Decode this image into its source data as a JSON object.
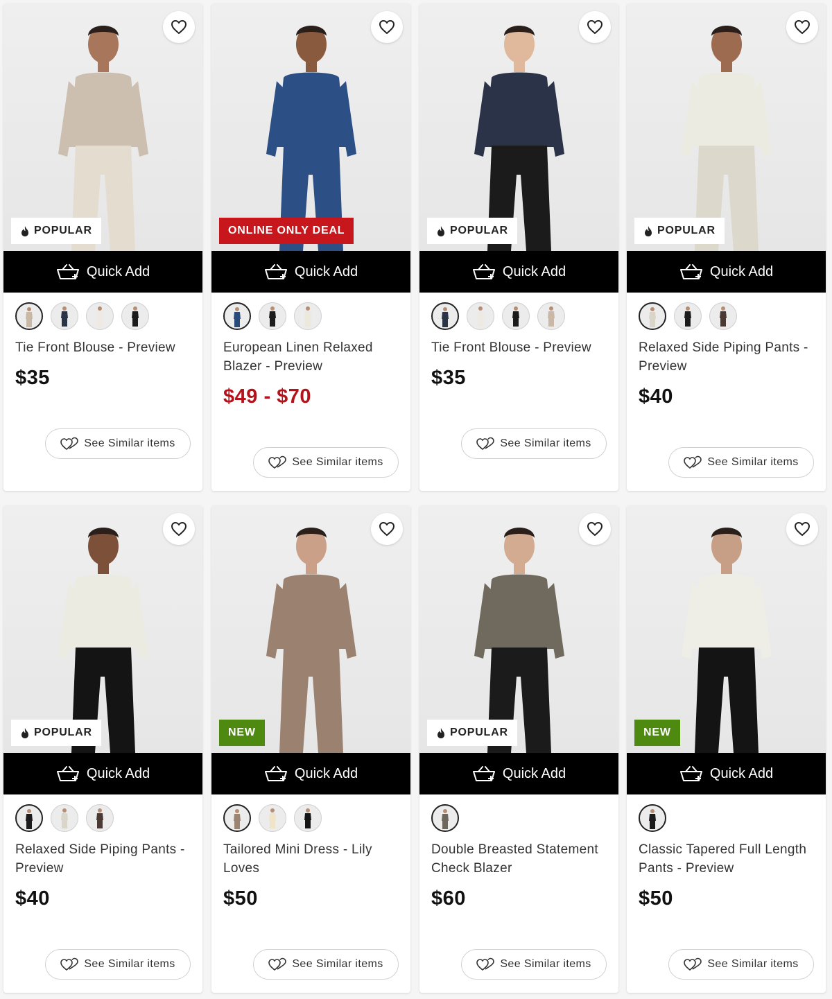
{
  "common": {
    "quick_add_label": "Quick Add",
    "similar_label": "See Similar items",
    "icons": {
      "favorite": "heart-icon",
      "quick_add": "basket-plus-icon",
      "similar": "hearts-icon",
      "popular": "flame-icon"
    },
    "colors": {
      "sale_price": "#b5121b",
      "badge_online": "#c8161d",
      "badge_new": "#4f8a10",
      "quick_add_bg": "#000000"
    }
  },
  "products": [
    {
      "title": "Tie Front Blouse - Preview",
      "price": "$35",
      "sale": false,
      "badge": {
        "type": "popular",
        "label": "POPULAR"
      },
      "swatches": [
        "#c9b8a6",
        "#2b3346",
        "#eeeae3",
        "#1a1a1a"
      ],
      "top_color": "#cdbfaf",
      "bottom_color": "#e4dccf"
    },
    {
      "title": "European Linen Relaxed Blazer - Preview",
      "price": "$49 - $70",
      "sale": true,
      "badge": {
        "type": "online",
        "label": "ONLINE ONLY DEAL"
      },
      "swatches": [
        "#284a7a",
        "#1c1c1c",
        "#ede8dc"
      ],
      "top_color": "#2c4f85",
      "bottom_color": "#2c4f85"
    },
    {
      "title": "Tie Front Blouse - Preview",
      "price": "$35",
      "sale": false,
      "badge": {
        "type": "popular",
        "label": "POPULAR"
      },
      "swatches": [
        "#2b3346",
        "#eeeae3",
        "#1a1a1a",
        "#c9b8a6"
      ],
      "top_color": "#2a3347",
      "bottom_color": "#1b1b1b"
    },
    {
      "title": "Relaxed Side Piping Pants - Preview",
      "price": "$40",
      "sale": false,
      "badge": {
        "type": "popular",
        "label": "POPULAR"
      },
      "swatches": [
        "#d9d5c9",
        "#1c1c1c",
        "#4a3a33"
      ],
      "top_color": "#ecebe2",
      "bottom_color": "#dcd8cc"
    },
    {
      "title": "Relaxed Side Piping Pants - Preview",
      "price": "$40",
      "sale": false,
      "badge": {
        "type": "popular",
        "label": "POPULAR"
      },
      "swatches": [
        "#1c1c1c",
        "#d9d5c9",
        "#4a3a33"
      ],
      "top_color": "#ecebe2",
      "bottom_color": "#141414"
    },
    {
      "title": "Tailored Mini Dress - Lily Loves",
      "price": "$50",
      "sale": false,
      "badge": {
        "type": "new",
        "label": "NEW"
      },
      "swatches": [
        "#9c8473",
        "#efe3c8",
        "#151515"
      ],
      "top_color": "#9a8170",
      "bottom_color": "#9a8170"
    },
    {
      "title": "Double Breasted Statement Check Blazer",
      "price": "$60",
      "sale": false,
      "badge": {
        "type": "popular",
        "label": "POPULAR"
      },
      "swatches": [
        "#6d675d"
      ],
      "top_color": "#6f695e",
      "bottom_color": "#1b1b1b"
    },
    {
      "title": "Classic Tapered Full Length Pants - Preview",
      "price": "$50",
      "sale": false,
      "badge": {
        "type": "new",
        "label": "NEW"
      },
      "swatches": [
        "#1c1c1c"
      ],
      "top_color": "#eeede6",
      "bottom_color": "#141414"
    }
  ]
}
